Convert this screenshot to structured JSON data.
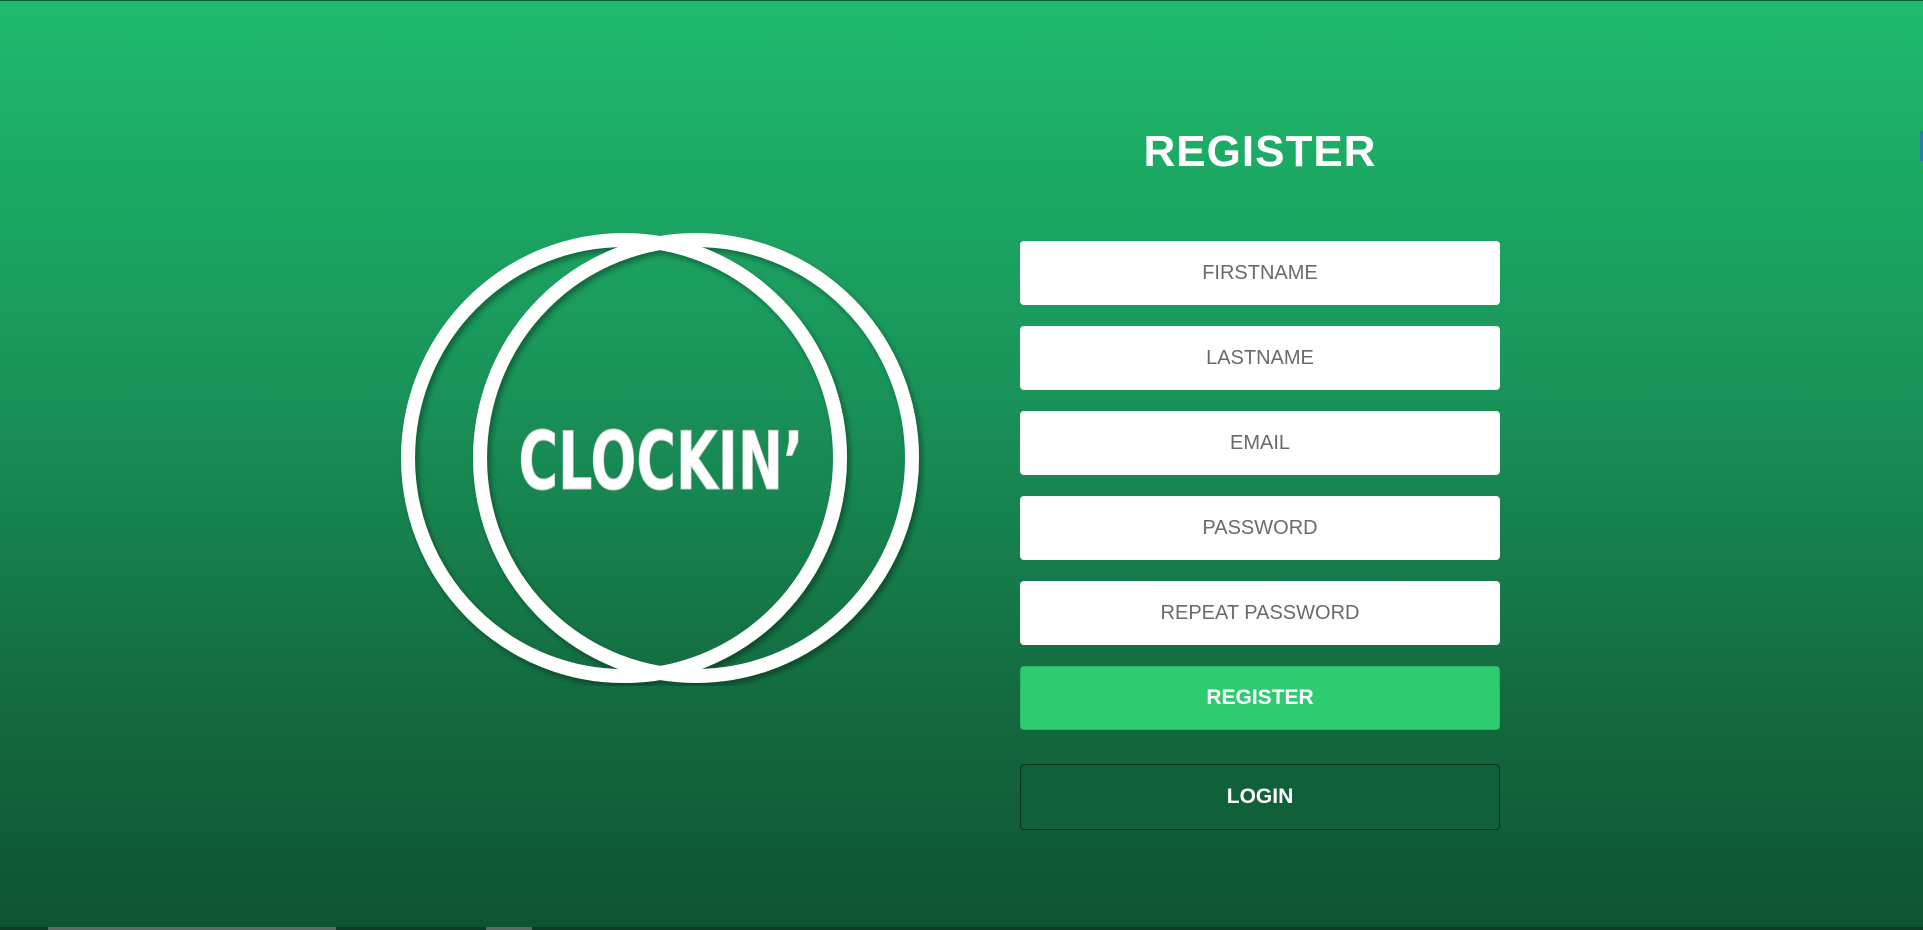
{
  "brand": {
    "logo_text": "CLOCKIN’"
  },
  "register_form": {
    "title": "REGISTER",
    "firstname_placeholder": "FIRSTNAME",
    "lastname_placeholder": "LASTNAME",
    "email_placeholder": "EMAIL",
    "password_placeholder": "PASSWORD",
    "repeat_password_placeholder": "REPEAT PASSWORD",
    "register_label": "REGISTER",
    "login_label": "LOGIN"
  },
  "colors": {
    "background_top": "#1fbb6d",
    "background_bottom": "#0f5331",
    "register_button": "#2ecc71",
    "login_button": "#10613a",
    "field_background": "#ffffff"
  }
}
